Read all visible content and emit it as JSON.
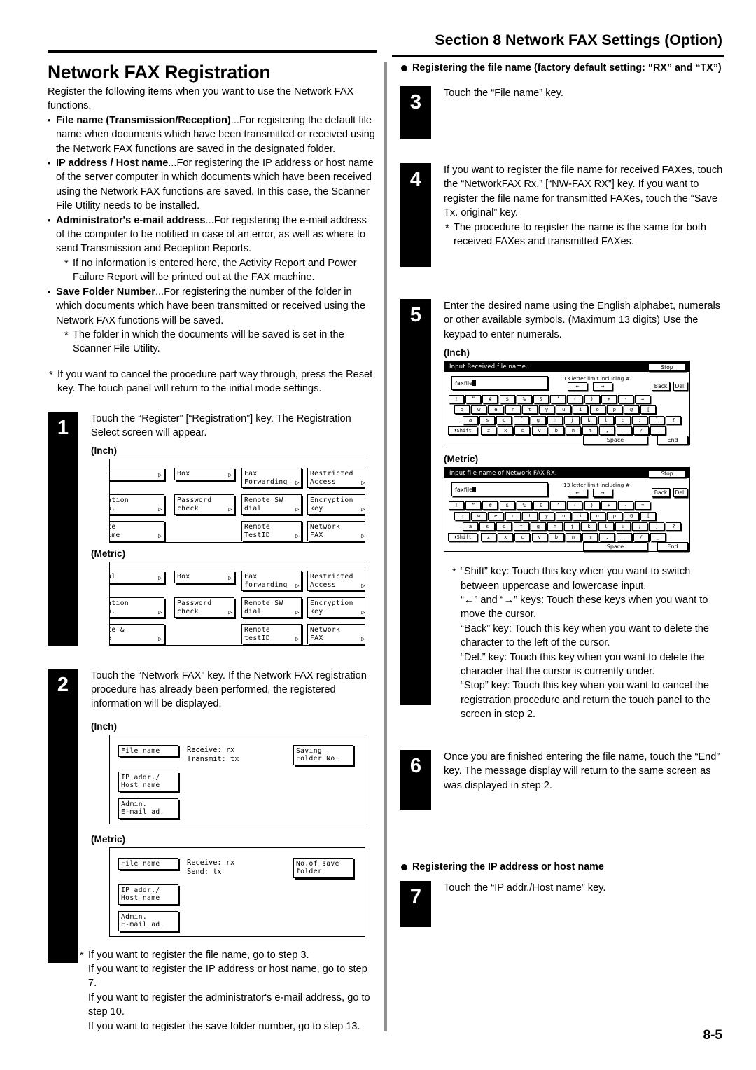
{
  "header": {
    "section_title": "Section 8 Network FAX Settings (Option)",
    "page_number": "8-5"
  },
  "left": {
    "title": "Network FAX Registration",
    "intro": "Register the following items when you want to use the Network FAX functions.",
    "items": [
      {
        "term": "File name (Transmission/Reception)",
        "text": "...For registering the default file name when documents which have been transmitted or received using the Network FAX functions are saved in the designated folder."
      },
      {
        "term": "IP address / Host name",
        "text": "...For registering the IP address or host name of the server computer in which documents which have been received using the Network FAX functions are saved. In this case, the Scanner File Utility needs to be installed."
      },
      {
        "term": "Administrator's e-mail address",
        "text": "...For registering the e-mail address of the computer to be notified in case of an error, as well as where to send Transmission and Reception Reports.",
        "note": "If no information is entered here, the Activity Report and Power Failure Report will be printed out at the FAX machine."
      },
      {
        "term": "Save Folder Number",
        "text": "...For registering the number of the folder in which documents which have been transmitted or received using the Network FAX functions will be saved.",
        "note": "The folder in which the documents will be saved is set in the Scanner File Utility."
      }
    ],
    "cancel_note": "If you want to cancel the procedure part way through, press the Reset key. The touch panel will return to the initial mode settings.",
    "step1": {
      "number": "1",
      "text": "Touch the “Register” [“Registration”] key. The Registration Select screen will appear.",
      "inch_label": "(Inch)",
      "metric_label": "(Metric)",
      "inch_keys": [
        "al",
        "Box",
        "Fax\nForwarding",
        "Restricted\nAccess",
        "cation\nfo.",
        "Password\ncheck",
        "Remote SW\ndial",
        "Encryption\nkey",
        "ate\nTime",
        "",
        "Remote\nTestID",
        "Network\nFAX"
      ],
      "metric_keys": [
        "ial",
        "Box",
        "Fax\nforwarding",
        "Restricted\nAccess",
        "cation\nfo.",
        "Password\ncheck",
        "Remote SW\ndial",
        "Encryption\nkey",
        "ate &\nme",
        "",
        "Remote\ntestID",
        "Network\nFAX"
      ]
    },
    "step2": {
      "number": "2",
      "text": "Touch the “Network FAX” key. If the Network FAX registration procedure has already been performed, the registered information will be displayed.",
      "inch_label": "(Inch)",
      "metric_label": "(Metric)",
      "inch_screen": {
        "file_name_key": "File name",
        "ip_key": "IP addr./\nHost name",
        "admin_key": "Admin.\nE-mail ad.",
        "folder_key": "Saving\nFolder No.",
        "status_line1": "Receive: rx",
        "status_line2": "Transmit: tx"
      },
      "metric_screen": {
        "file_name_key": "File name",
        "ip_key": "IP addr./\nHost name",
        "admin_key": "Admin.\nE-mail ad.",
        "folder_key": "No.of save\nfolder",
        "status_line1": "Receive: rx",
        "status_line2": "Send: tx"
      }
    },
    "goto_notes": [
      "If you want to register the file name, go to step 3.",
      "If you want to register the IP address or host name, go to step 7.",
      "If you want to register the administrator's e-mail address, go to step 10.",
      "If you want to register the save folder number, go to step 13."
    ]
  },
  "right": {
    "section_file_name": "Registering the file name (factory default setting: “RX” and “TX”)",
    "step3": {
      "number": "3",
      "text": "Touch the “File name” key."
    },
    "step4": {
      "number": "4",
      "text": "If you want to register the file name for received FAXes, touch the “NetworkFAX Rx.” [“NW-FAX RX”] key. If you want to register the file name for transmitted FAXes, touch the “Save Tx. original” key.",
      "note": "The procedure to register the name is the same for both received FAXes and transmitted FAXes."
    },
    "step5": {
      "number": "5",
      "text": "Enter the desired name using the English alphabet, numerals or other available symbols. (Maximum 13 digits) Use the keypad to enter numerals.",
      "inch_label": "(Inch)",
      "metric_label": "(Metric)",
      "inch_keyboard": {
        "title": "Input Received file name.",
        "stop": "Stop",
        "value": "faxfile",
        "limit": "13 letter limit including #",
        "arrow_left": "←",
        "arrow_right": "→",
        "back": "Back",
        "del": "Del.",
        "row1": [
          "!",
          "”",
          "#",
          "$",
          "%",
          "&",
          "’",
          "(",
          ")",
          "+",
          "-",
          "="
        ],
        "row2": [
          "q",
          "w",
          "e",
          "r",
          "t",
          "y",
          "u",
          "i",
          "o",
          "p",
          "@",
          "["
        ],
        "row3": [
          "a",
          "s",
          "d",
          "f",
          "g",
          "h",
          "j",
          "k",
          "l",
          ":",
          ";",
          "]",
          "?"
        ],
        "shift": "Shift",
        "row4": [
          "z",
          "x",
          "c",
          "v",
          "b",
          "n",
          "m",
          ",",
          ".",
          "/",
          "_"
        ],
        "space": "Space",
        "end": "End"
      },
      "metric_keyboard": {
        "title": "Input file name of Network FAX RX.",
        "stop": "Stop",
        "value": "faxfile",
        "limit": "13 letter limit including #",
        "arrow_left": "←",
        "arrow_right": "→",
        "back": "Back",
        "del": "Del.",
        "row1": [
          "!",
          "”",
          "#",
          "$",
          "%",
          "&",
          "’",
          "(",
          ")",
          "+",
          "-",
          "="
        ],
        "row2": [
          "q",
          "w",
          "e",
          "r",
          "t",
          "y",
          "u",
          "i",
          "o",
          "p",
          "@",
          "["
        ],
        "row3": [
          "a",
          "s",
          "d",
          "f",
          "g",
          "h",
          "j",
          "k",
          "l",
          ":",
          ";",
          "]",
          "?"
        ],
        "shift": "Shift",
        "row4": [
          "z",
          "x",
          "c",
          "v",
          "b",
          "n",
          "m",
          ",",
          ".",
          "/",
          "_"
        ],
        "space": "Space",
        "end": "End"
      },
      "key_notes": [
        "“Shift” key: Touch this key when you want to switch between uppercase and lowercase input.",
        "“←” and “→” keys: Touch these keys when you want to move the cursor.",
        "“Back” key: Touch this key when you want to delete the character to the left of the cursor.",
        "“Del.” key: Touch this key when you want to delete the character that the cursor is currently under.",
        "“Stop” key: Touch this key when you want to cancel the registration procedure and return the touch panel to the screen in step 2."
      ]
    },
    "step6": {
      "number": "6",
      "text": "Once you are finished entering the file name, touch the “End” key. The message display will return to the same screen as was displayed in step 2."
    },
    "section_ip": "Registering the IP address or host name",
    "step7": {
      "number": "7",
      "text": "Touch the “IP addr./Host name” key."
    }
  }
}
